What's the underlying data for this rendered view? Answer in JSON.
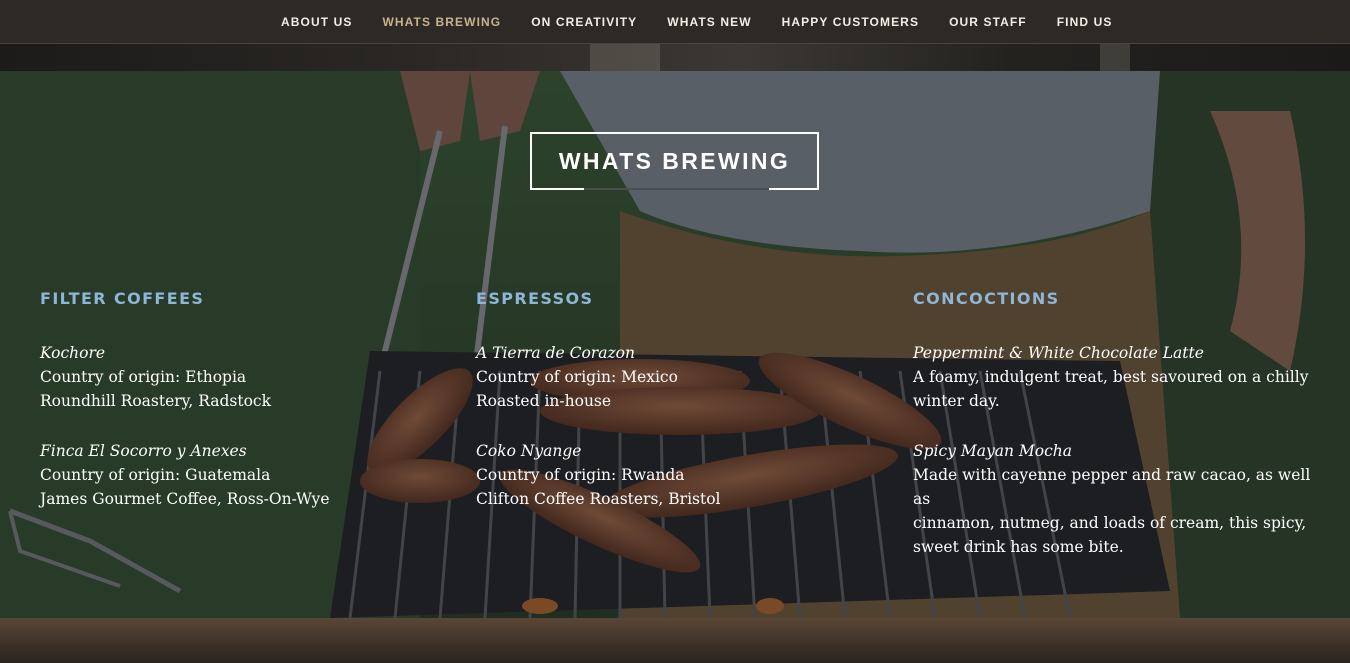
{
  "nav": {
    "items": [
      {
        "label": "ABOUT US",
        "active": false
      },
      {
        "label": "WHATS BREWING",
        "active": true
      },
      {
        "label": "ON CREATIVITY",
        "active": false
      },
      {
        "label": "WHATS NEW",
        "active": false
      },
      {
        "label": "HAPPY CUSTOMERS",
        "active": false
      },
      {
        "label": "OUR STAFF",
        "active": false
      },
      {
        "label": "FIND US",
        "active": false
      }
    ],
    "active_color": "#c9b28f",
    "text_color": "#f2eee6"
  },
  "section": {
    "title": "WHATS BREWING",
    "heading_color": "#8fb6d6",
    "columns": [
      {
        "heading": "FILTER COFFEES",
        "entries": [
          {
            "name": "Kochore",
            "lines": [
              "Country of origin: Ethopia",
              "Roundhill Roastery, Radstock"
            ]
          },
          {
            "name": "Finca El Socorro y Anexes",
            "lines": [
              "Country of origin: Guatemala",
              "James Gourmet Coffee, Ross-On-Wye"
            ]
          }
        ]
      },
      {
        "heading": "ESPRESSOS",
        "entries": [
          {
            "name": "A Tierra de Corazon",
            "lines": [
              "Country of origin: Mexico",
              "Roasted in-house"
            ]
          },
          {
            "name": "Coko Nyange",
            "lines": [
              "Country of origin: Rwanda",
              "Clifton Coffee Roasters, Bristol"
            ]
          }
        ]
      },
      {
        "heading": "CONCOCTIONS",
        "entries": [
          {
            "name": "Peppermint & White Chocolate Latte",
            "lines": [
              "A foamy, indulgent treat, best savoured on a chilly",
              "winter day."
            ]
          },
          {
            "name": "Spicy Mayan Mocha",
            "lines": [
              "Made with cayenne pepper and raw cacao, as well as",
              "cinnamon, nutmeg, and loads of cream, this spicy,",
              "sweet drink has some bite."
            ]
          }
        ]
      }
    ]
  }
}
